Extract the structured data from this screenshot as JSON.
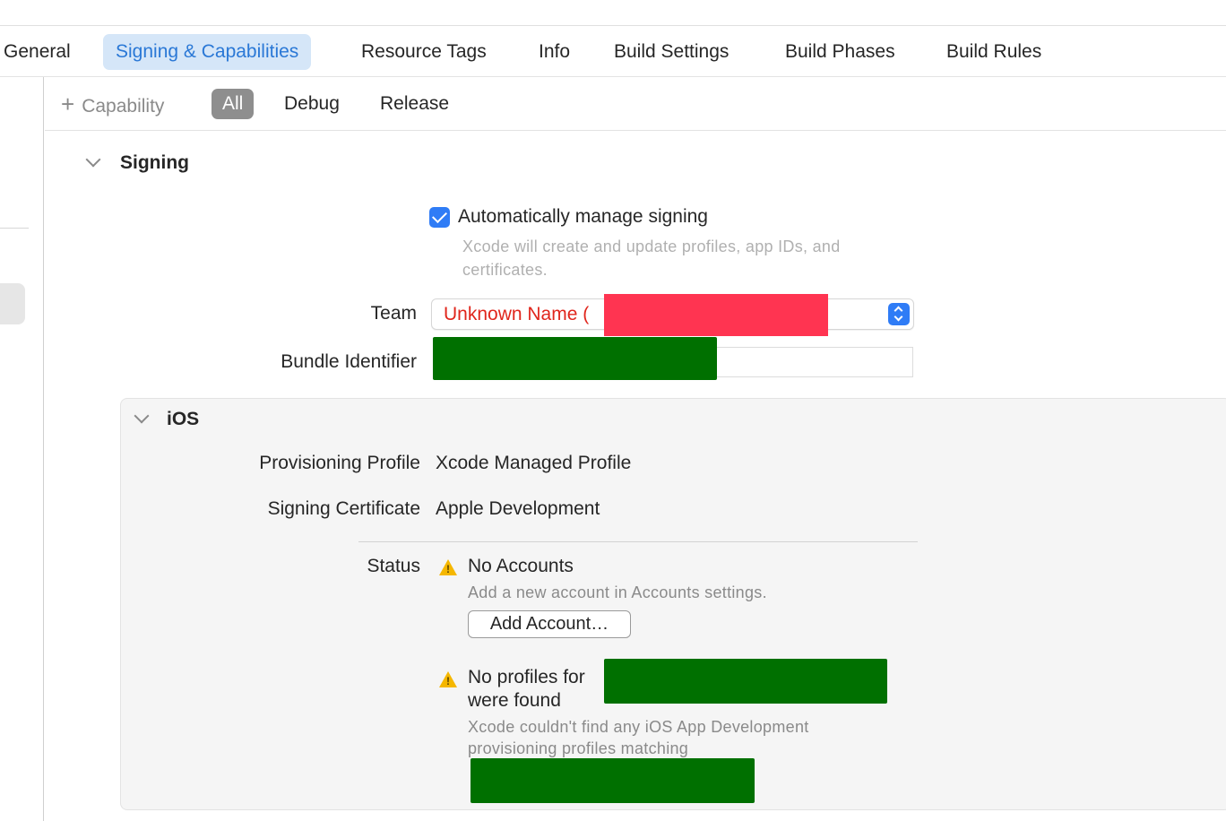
{
  "tabs": [
    {
      "label": "General"
    },
    {
      "label": "Signing & Capabilities",
      "active": true
    },
    {
      "label": "Resource Tags"
    },
    {
      "label": "Info"
    },
    {
      "label": "Build Settings"
    },
    {
      "label": "Build Phases"
    },
    {
      "label": "Build Rules"
    }
  ],
  "subbar": {
    "capability_label": "Capability",
    "plus_glyph": "+",
    "segments": [
      "All",
      "Debug",
      "Release"
    ],
    "selected_segment": "All"
  },
  "signing": {
    "title": "Signing",
    "auto_manage_label": "Automatically manage signing",
    "auto_manage_checked": true,
    "auto_manage_help": "Xcode will create and update profiles, app IDs, and certificates.",
    "team_label": "Team",
    "team_value": "Unknown Name (",
    "bundle_label": "Bundle Identifier"
  },
  "ios": {
    "title": "iOS",
    "provisioning_label": "Provisioning Profile",
    "provisioning_value": "Xcode Managed Profile",
    "certificate_label": "Signing Certificate",
    "certificate_value": "Apple Development",
    "status_label": "Status",
    "warning1_title": "No Accounts",
    "warning1_sub": "Add a new account in Accounts settings.",
    "add_account_label": "Add Account…",
    "warning2_title_line1": "No profiles for",
    "warning2_title_line2": "were found",
    "warning2_sub_line1": "Xcode couldn't find any iOS App Development",
    "warning2_sub_line2": "provisioning profiles matching"
  },
  "icons": {
    "checkbox": "checkmark-icon",
    "warning": "warning-triangle-icon",
    "disclosure": "chevron-down-icon",
    "popup": "up-down-stepper-icon",
    "add": "plus-icon"
  },
  "colors": {
    "accent": "#2f7cf6",
    "active_tab_bg": "#d5e6f8",
    "active_tab_text": "#2a78d6",
    "error_text": "#e0261c",
    "warning": "#f5b700",
    "redaction_red": "#ff3451",
    "redaction_green": "#007000"
  }
}
